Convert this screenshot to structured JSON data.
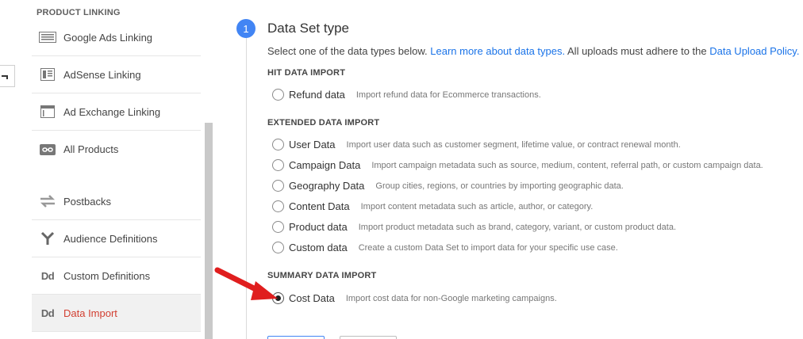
{
  "sidebar": {
    "section_title": "PRODUCT LINKING",
    "items": [
      {
        "label": "Google Ads Linking",
        "icon": "google-ads-icon"
      },
      {
        "label": "AdSense Linking",
        "icon": "adsense-icon"
      },
      {
        "label": "Ad Exchange Linking",
        "icon": "ad-exchange-icon"
      },
      {
        "label": "All Products",
        "icon": "link-icon"
      },
      {
        "label": "Postbacks",
        "icon": "postbacks-icon"
      },
      {
        "label": "Audience Definitions",
        "icon": "audience-icon"
      },
      {
        "label": "Custom Definitions",
        "icon": "dd-icon",
        "glyph": "Dd"
      },
      {
        "label": "Data Import",
        "icon": "dd-icon",
        "glyph": "Dd",
        "active": true
      }
    ]
  },
  "step": {
    "number": "1",
    "title": "Data Set type",
    "desc_prefix": "Select one of the data types below. ",
    "desc_link1": "Learn more about data types.",
    "desc_middle": " All uploads must adhere to the ",
    "desc_link2": "Data Upload Policy."
  },
  "groups": {
    "hit": "HIT DATA IMPORT",
    "extended": "EXTENDED DATA IMPORT",
    "summary": "SUMMARY DATA IMPORT"
  },
  "options": {
    "refund": {
      "name": "Refund data",
      "hint": "Import refund data for Ecommerce transactions."
    },
    "user": {
      "name": "User Data",
      "hint": "Import user data such as customer segment, lifetime value, or contract renewal month."
    },
    "campaign": {
      "name": "Campaign Data",
      "hint": "Import campaign metadata such as source, medium, content, referral path, or custom campaign data."
    },
    "geography": {
      "name": "Geography Data",
      "hint": "Group cities, regions, or countries by importing geographic data."
    },
    "content": {
      "name": "Content Data",
      "hint": "Import content metadata such as article, author, or category."
    },
    "product": {
      "name": "Product data",
      "hint": "Import product metadata such as brand, category, variant, or custom product data."
    },
    "custom": {
      "name": "Custom data",
      "hint": "Create a custom Data Set to import data for your specific use case."
    },
    "cost": {
      "name": "Cost Data",
      "hint": "Import cost data for non-Google marketing campaigns.",
      "selected": true
    }
  },
  "colors": {
    "accent": "#4285f4",
    "link": "#1a73e8",
    "active_nav": "#d23f31",
    "arrow": "#e01e1e"
  }
}
